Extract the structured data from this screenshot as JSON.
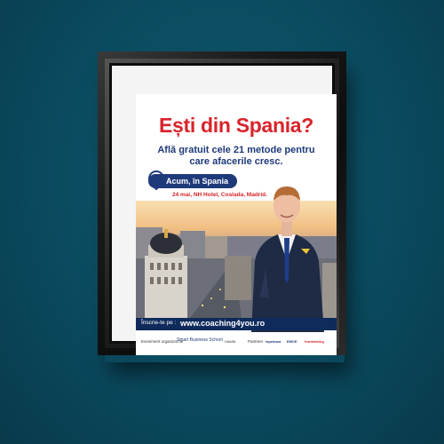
{
  "poster": {
    "headline": "Ești din Spania?",
    "subheadline": "Află gratuit cele 21 metode pentru care afacerile cresc.",
    "location_badge": "Acum, în Spania",
    "event_detail": "24 mai, NH Hotel, Coslada, Madrid.",
    "cta_label": "Înscrie-te pe :",
    "cta_url": "www.coaching4you.ro",
    "footer": {
      "organizer_label": "Eveniment organizat de",
      "organizer_brand": "Smart Business School",
      "organizer_small": "HAMM",
      "partner_label": "Partener",
      "sponsors": [
        "ispeduca",
        "EMCE",
        "fundraising"
      ]
    }
  },
  "colors": {
    "background": "#0b4a5f",
    "headline": "#d9232a",
    "brand_blue": "#1f3a7a",
    "cta_bar": "#0e2b5c",
    "frame": "#111111"
  },
  "icons": [
    "location-pin-icon"
  ]
}
